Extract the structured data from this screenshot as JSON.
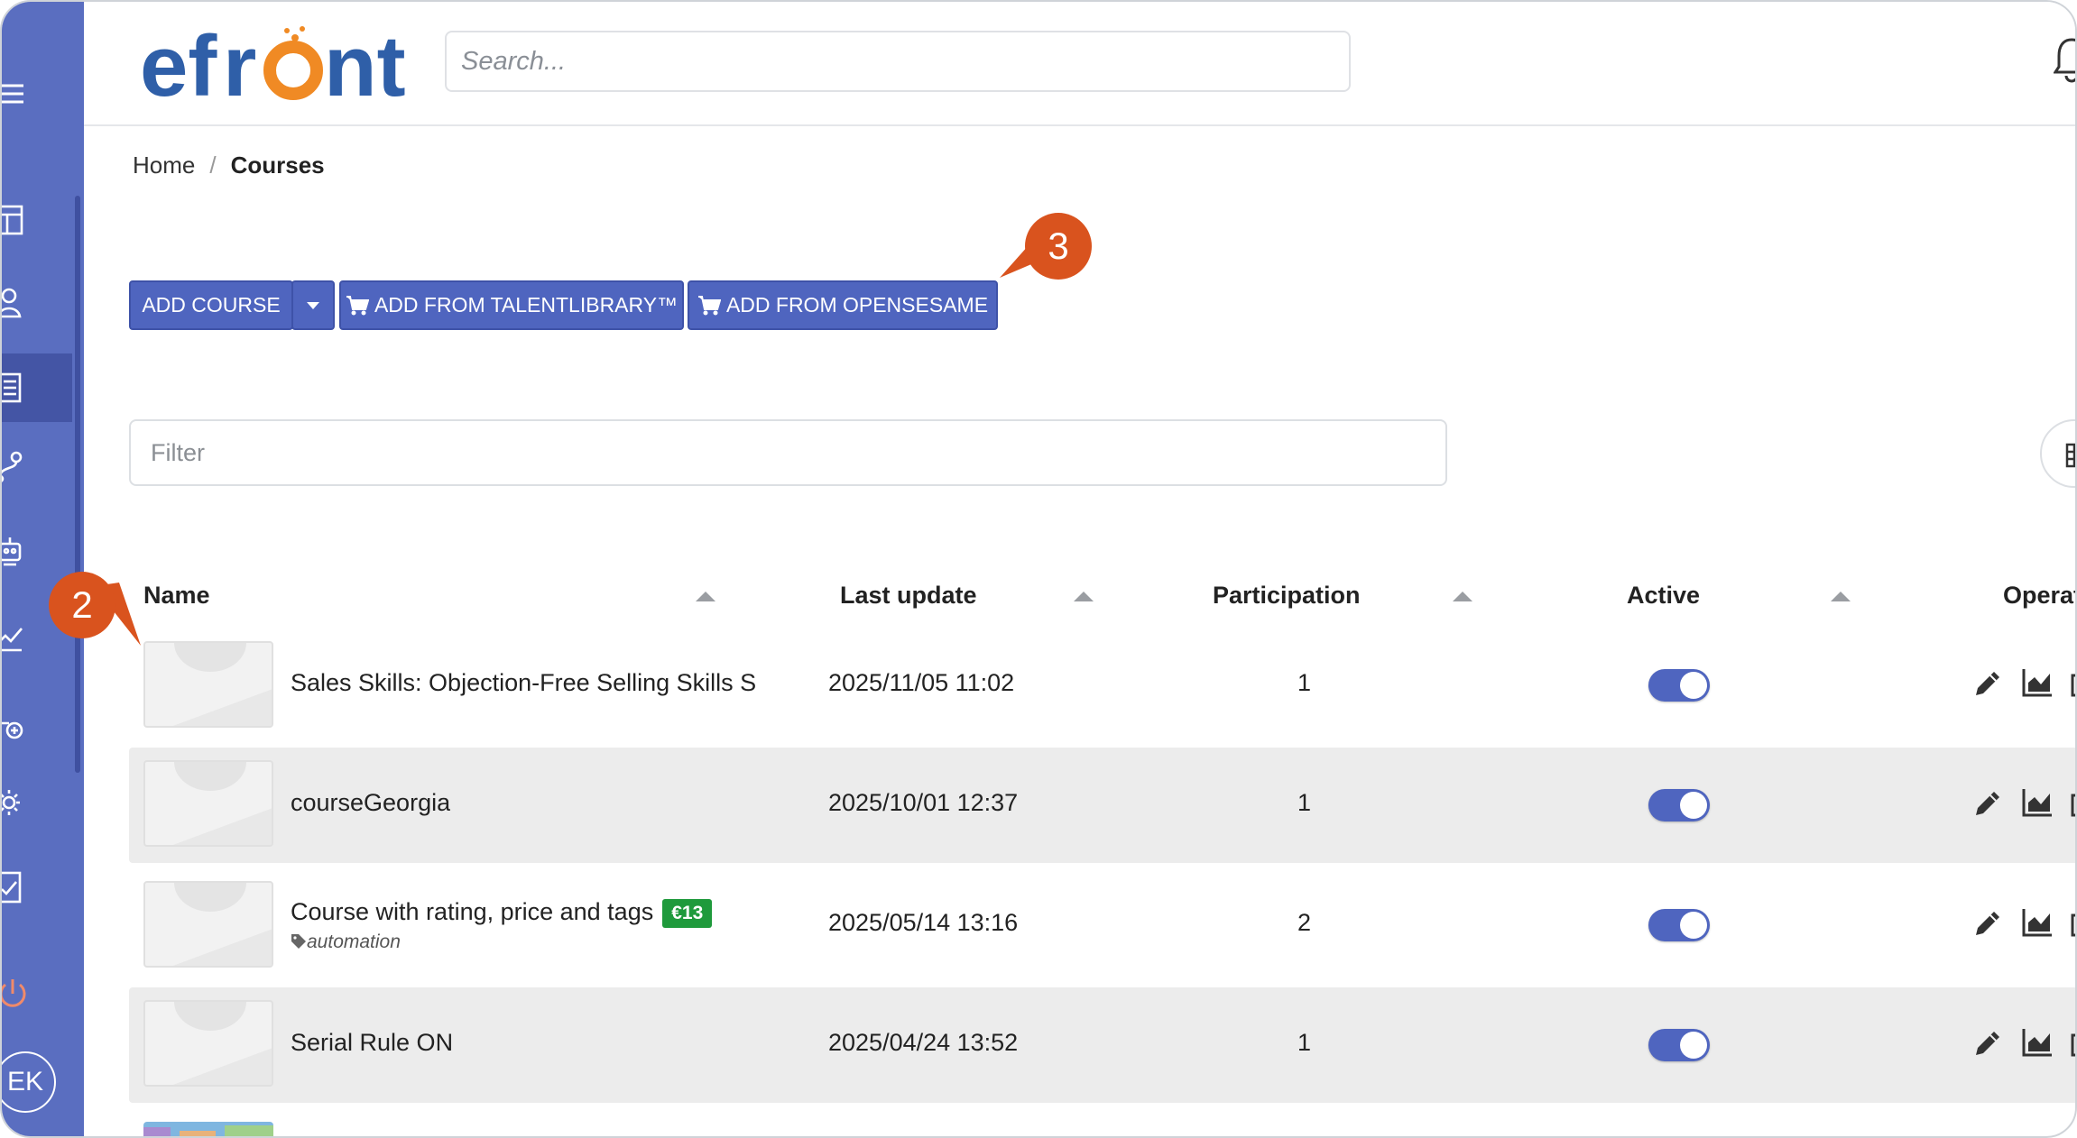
{
  "sidebar": {
    "items": [
      {
        "icon": "menu-icon"
      },
      {
        "icon": "dashboard-icon"
      },
      {
        "icon": "users-icon"
      },
      {
        "icon": "courses-icon"
      },
      {
        "icon": "learning-paths-icon"
      },
      {
        "icon": "automations-icon"
      },
      {
        "icon": "reports-icon"
      },
      {
        "icon": "skills-icon"
      },
      {
        "icon": "settings-icon"
      },
      {
        "icon": "assignments-icon"
      },
      {
        "icon": "logout-icon"
      }
    ],
    "avatar_initials": "EK"
  },
  "header": {
    "logo": "efront",
    "search_placeholder": "Search..."
  },
  "breadcrumb": {
    "home": "Home",
    "separator": "/",
    "current": "Courses"
  },
  "toolbar": {
    "add_course": "ADD COURSE",
    "add_talentlibrary": "ADD FROM TALENTLIBRARY™",
    "add_opensesame": "ADD FROM OPENSESAME"
  },
  "callouts": {
    "first": "2",
    "second": "3"
  },
  "filter": {
    "placeholder": "Filter"
  },
  "table": {
    "headers": {
      "name": "Name",
      "last_update": "Last update",
      "participation": "Participation",
      "active": "Active",
      "operations": "Operat"
    },
    "rows": [
      {
        "name": "Sales Skills: Objection-Free Selling Skills S",
        "last_update": "2025/11/05 11:02",
        "participation": "1",
        "active": true
      },
      {
        "name": "courseGeorgia",
        "last_update": "2025/10/01 12:37",
        "participation": "1",
        "active": true
      },
      {
        "name": "Course with rating, price and tags",
        "price": "€13",
        "tag": "automation",
        "last_update": "2025/05/14 13:16",
        "participation": "2",
        "active": true
      },
      {
        "name": "Serial Rule ON",
        "last_update": "2025/04/24 13:52",
        "participation": "1",
        "active": true
      }
    ]
  },
  "colors": {
    "sidebar": "#5a6ec0",
    "primary": "#4f65bf",
    "callout": "#d9531e",
    "price": "#1f9a3c",
    "logo_blue": "#2f5fa8",
    "logo_orange": "#f08a24"
  }
}
